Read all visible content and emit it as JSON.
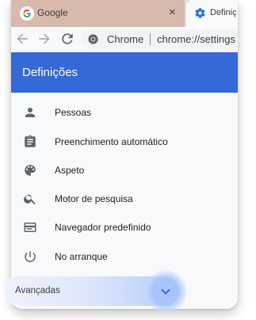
{
  "tabs": [
    {
      "title": "Google",
      "icon": "google-icon",
      "close": "×"
    },
    {
      "title": "Definiç",
      "icon": "gear-icon"
    }
  ],
  "toolbar": {
    "back_icon": "back-arrow-icon",
    "forward_icon": "forward-arrow-icon",
    "reload_icon": "reload-icon"
  },
  "omnibox": {
    "chip_label": "Chrome",
    "url": "chrome://settings"
  },
  "header": {
    "title": "Definições"
  },
  "menu": [
    {
      "label": "Pessoas",
      "icon": "person-icon"
    },
    {
      "label": "Preenchimento automático",
      "icon": "clipboard-icon"
    },
    {
      "label": "Aspeto",
      "icon": "palette-icon"
    },
    {
      "label": "Motor de pesquisa",
      "icon": "search-icon"
    },
    {
      "label": "Navegador predefinido",
      "icon": "browser-window-icon"
    },
    {
      "label": "No arranque",
      "icon": "power-icon"
    }
  ],
  "advanced": {
    "label": "Avançadas",
    "icon": "chevron-down-icon"
  },
  "colors": {
    "header_blue": "#3469d6",
    "tab_inactive": "#d7b9ad",
    "accent_light": "#a8c4fa"
  }
}
